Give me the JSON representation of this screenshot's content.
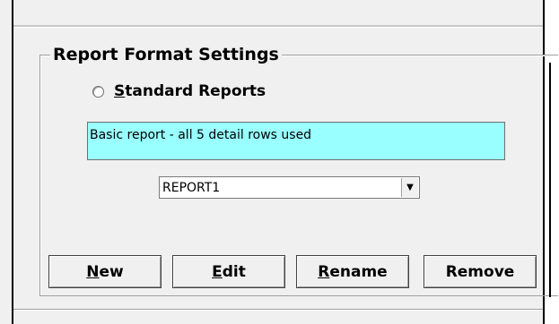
{
  "group": {
    "title": "Report Format Settings"
  },
  "radio": {
    "label_mnemonic": "S",
    "label_rest": "tandard Reports",
    "selected": false
  },
  "description": {
    "text": "Basic report - all 5 detail rows used",
    "background": "#99ffff"
  },
  "combo": {
    "value": "REPORT1",
    "arrow": "▼"
  },
  "buttons": {
    "new": {
      "mnemonic": "N",
      "rest": "ew"
    },
    "edit": {
      "mnemonic": "E",
      "rest": "dit"
    },
    "rename": {
      "mnemonic": "R",
      "rest": "ename"
    },
    "remove": {
      "label": "Remove"
    }
  }
}
